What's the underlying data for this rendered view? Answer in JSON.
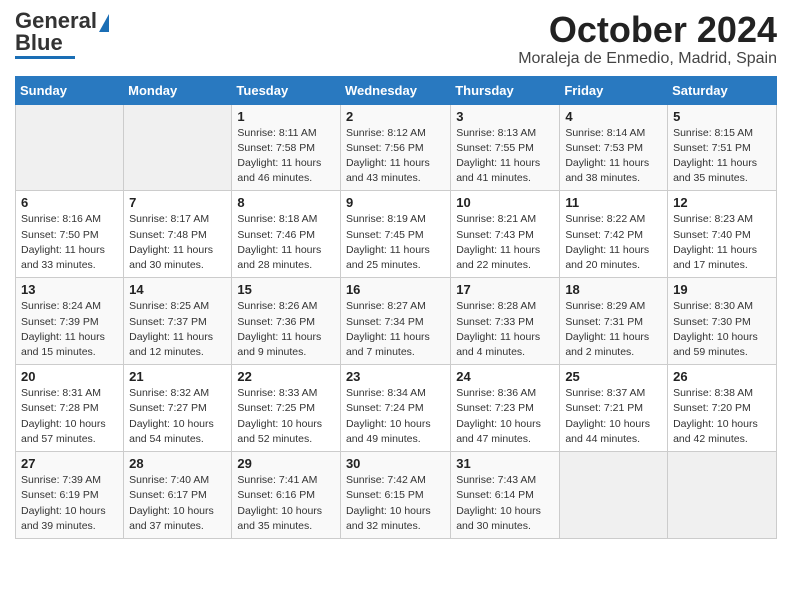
{
  "header": {
    "logo_general": "General",
    "logo_blue": "Blue",
    "month_year": "October 2024",
    "location": "Moraleja de Enmedio, Madrid, Spain"
  },
  "weekdays": [
    "Sunday",
    "Monday",
    "Tuesday",
    "Wednesday",
    "Thursday",
    "Friday",
    "Saturday"
  ],
  "weeks": [
    [
      {
        "day": "",
        "sunrise": "",
        "sunset": "",
        "daylight": ""
      },
      {
        "day": "",
        "sunrise": "",
        "sunset": "",
        "daylight": ""
      },
      {
        "day": "1",
        "sunrise": "Sunrise: 8:11 AM",
        "sunset": "Sunset: 7:58 PM",
        "daylight": "Daylight: 11 hours and 46 minutes."
      },
      {
        "day": "2",
        "sunrise": "Sunrise: 8:12 AM",
        "sunset": "Sunset: 7:56 PM",
        "daylight": "Daylight: 11 hours and 43 minutes."
      },
      {
        "day": "3",
        "sunrise": "Sunrise: 8:13 AM",
        "sunset": "Sunset: 7:55 PM",
        "daylight": "Daylight: 11 hours and 41 minutes."
      },
      {
        "day": "4",
        "sunrise": "Sunrise: 8:14 AM",
        "sunset": "Sunset: 7:53 PM",
        "daylight": "Daylight: 11 hours and 38 minutes."
      },
      {
        "day": "5",
        "sunrise": "Sunrise: 8:15 AM",
        "sunset": "Sunset: 7:51 PM",
        "daylight": "Daylight: 11 hours and 35 minutes."
      }
    ],
    [
      {
        "day": "6",
        "sunrise": "Sunrise: 8:16 AM",
        "sunset": "Sunset: 7:50 PM",
        "daylight": "Daylight: 11 hours and 33 minutes."
      },
      {
        "day": "7",
        "sunrise": "Sunrise: 8:17 AM",
        "sunset": "Sunset: 7:48 PM",
        "daylight": "Daylight: 11 hours and 30 minutes."
      },
      {
        "day": "8",
        "sunrise": "Sunrise: 8:18 AM",
        "sunset": "Sunset: 7:46 PM",
        "daylight": "Daylight: 11 hours and 28 minutes."
      },
      {
        "day": "9",
        "sunrise": "Sunrise: 8:19 AM",
        "sunset": "Sunset: 7:45 PM",
        "daylight": "Daylight: 11 hours and 25 minutes."
      },
      {
        "day": "10",
        "sunrise": "Sunrise: 8:21 AM",
        "sunset": "Sunset: 7:43 PM",
        "daylight": "Daylight: 11 hours and 22 minutes."
      },
      {
        "day": "11",
        "sunrise": "Sunrise: 8:22 AM",
        "sunset": "Sunset: 7:42 PM",
        "daylight": "Daylight: 11 hours and 20 minutes."
      },
      {
        "day": "12",
        "sunrise": "Sunrise: 8:23 AM",
        "sunset": "Sunset: 7:40 PM",
        "daylight": "Daylight: 11 hours and 17 minutes."
      }
    ],
    [
      {
        "day": "13",
        "sunrise": "Sunrise: 8:24 AM",
        "sunset": "Sunset: 7:39 PM",
        "daylight": "Daylight: 11 hours and 15 minutes."
      },
      {
        "day": "14",
        "sunrise": "Sunrise: 8:25 AM",
        "sunset": "Sunset: 7:37 PM",
        "daylight": "Daylight: 11 hours and 12 minutes."
      },
      {
        "day": "15",
        "sunrise": "Sunrise: 8:26 AM",
        "sunset": "Sunset: 7:36 PM",
        "daylight": "Daylight: 11 hours and 9 minutes."
      },
      {
        "day": "16",
        "sunrise": "Sunrise: 8:27 AM",
        "sunset": "Sunset: 7:34 PM",
        "daylight": "Daylight: 11 hours and 7 minutes."
      },
      {
        "day": "17",
        "sunrise": "Sunrise: 8:28 AM",
        "sunset": "Sunset: 7:33 PM",
        "daylight": "Daylight: 11 hours and 4 minutes."
      },
      {
        "day": "18",
        "sunrise": "Sunrise: 8:29 AM",
        "sunset": "Sunset: 7:31 PM",
        "daylight": "Daylight: 11 hours and 2 minutes."
      },
      {
        "day": "19",
        "sunrise": "Sunrise: 8:30 AM",
        "sunset": "Sunset: 7:30 PM",
        "daylight": "Daylight: 10 hours and 59 minutes."
      }
    ],
    [
      {
        "day": "20",
        "sunrise": "Sunrise: 8:31 AM",
        "sunset": "Sunset: 7:28 PM",
        "daylight": "Daylight: 10 hours and 57 minutes."
      },
      {
        "day": "21",
        "sunrise": "Sunrise: 8:32 AM",
        "sunset": "Sunset: 7:27 PM",
        "daylight": "Daylight: 10 hours and 54 minutes."
      },
      {
        "day": "22",
        "sunrise": "Sunrise: 8:33 AM",
        "sunset": "Sunset: 7:25 PM",
        "daylight": "Daylight: 10 hours and 52 minutes."
      },
      {
        "day": "23",
        "sunrise": "Sunrise: 8:34 AM",
        "sunset": "Sunset: 7:24 PM",
        "daylight": "Daylight: 10 hours and 49 minutes."
      },
      {
        "day": "24",
        "sunrise": "Sunrise: 8:36 AM",
        "sunset": "Sunset: 7:23 PM",
        "daylight": "Daylight: 10 hours and 47 minutes."
      },
      {
        "day": "25",
        "sunrise": "Sunrise: 8:37 AM",
        "sunset": "Sunset: 7:21 PM",
        "daylight": "Daylight: 10 hours and 44 minutes."
      },
      {
        "day": "26",
        "sunrise": "Sunrise: 8:38 AM",
        "sunset": "Sunset: 7:20 PM",
        "daylight": "Daylight: 10 hours and 42 minutes."
      }
    ],
    [
      {
        "day": "27",
        "sunrise": "Sunrise: 7:39 AM",
        "sunset": "Sunset: 6:19 PM",
        "daylight": "Daylight: 10 hours and 39 minutes."
      },
      {
        "day": "28",
        "sunrise": "Sunrise: 7:40 AM",
        "sunset": "Sunset: 6:17 PM",
        "daylight": "Daylight: 10 hours and 37 minutes."
      },
      {
        "day": "29",
        "sunrise": "Sunrise: 7:41 AM",
        "sunset": "Sunset: 6:16 PM",
        "daylight": "Daylight: 10 hours and 35 minutes."
      },
      {
        "day": "30",
        "sunrise": "Sunrise: 7:42 AM",
        "sunset": "Sunset: 6:15 PM",
        "daylight": "Daylight: 10 hours and 32 minutes."
      },
      {
        "day": "31",
        "sunrise": "Sunrise: 7:43 AM",
        "sunset": "Sunset: 6:14 PM",
        "daylight": "Daylight: 10 hours and 30 minutes."
      },
      {
        "day": "",
        "sunrise": "",
        "sunset": "",
        "daylight": ""
      },
      {
        "day": "",
        "sunrise": "",
        "sunset": "",
        "daylight": ""
      }
    ]
  ]
}
